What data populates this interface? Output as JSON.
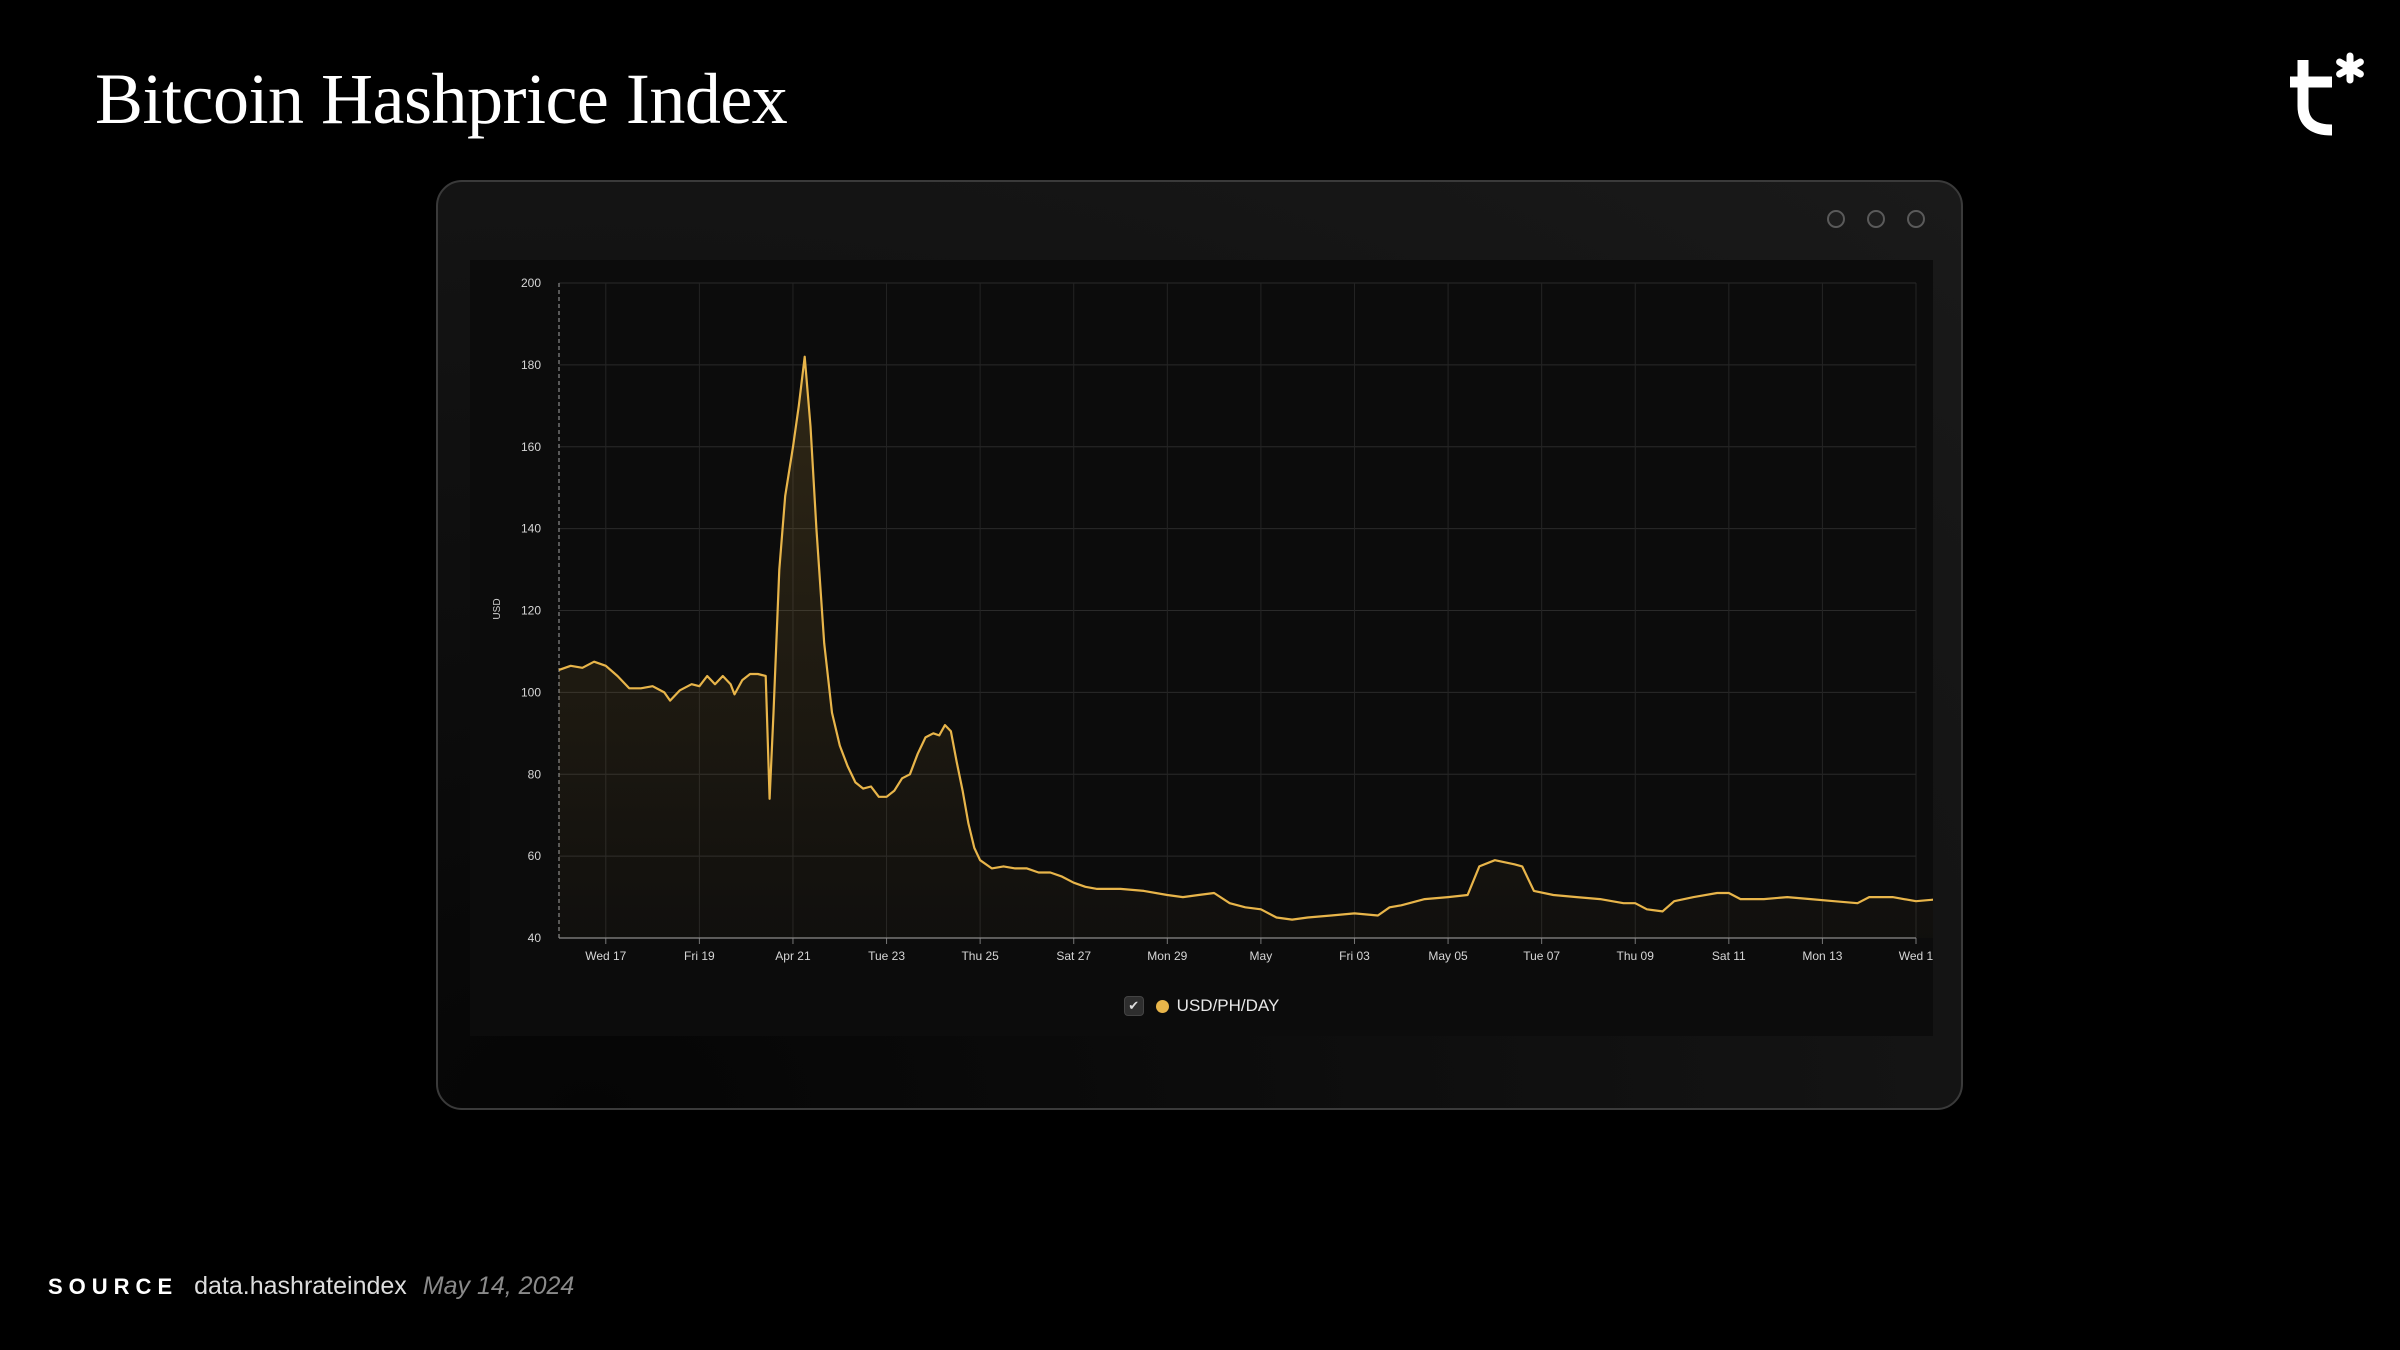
{
  "page": {
    "title": "Bitcoin Hashprice Index",
    "logo_icon": "tether-asterisk-logo-icon"
  },
  "window": {
    "controls": [
      "circle",
      "circle",
      "circle"
    ]
  },
  "legend": {
    "check": "✔",
    "label": "USD/PH/DAY",
    "color": "#e8b54a"
  },
  "source": {
    "key": "SOURCE",
    "site": "data.hashrateindex",
    "date": "May 14, 2024"
  },
  "colors": {
    "accent": "#e8b54a",
    "background": "#000000",
    "panel": "#0c0c0c"
  },
  "chart_data": {
    "type": "area",
    "ylabel": "USD",
    "ylim": [
      40,
      200
    ],
    "yticks": [
      40,
      60,
      80,
      100,
      120,
      140,
      160,
      180,
      200
    ],
    "xlim": [
      "2024-04-16",
      "2024-05-15"
    ],
    "xticks": [
      {
        "date": "2024-04-17",
        "label": "Wed 17"
      },
      {
        "date": "2024-04-19",
        "label": "Fri 19"
      },
      {
        "date": "2024-04-21",
        "label": "Apr 21"
      },
      {
        "date": "2024-04-23",
        "label": "Tue 23"
      },
      {
        "date": "2024-04-25",
        "label": "Thu 25"
      },
      {
        "date": "2024-04-27",
        "label": "Sat 27"
      },
      {
        "date": "2024-04-29",
        "label": "Mon 29"
      },
      {
        "date": "2024-05-01",
        "label": "May"
      },
      {
        "date": "2024-05-03",
        "label": "Fri 03"
      },
      {
        "date": "2024-05-05",
        "label": "May 05"
      },
      {
        "date": "2024-05-07",
        "label": "Tue 07"
      },
      {
        "date": "2024-05-09",
        "label": "Thu 09"
      },
      {
        "date": "2024-05-11",
        "label": "Sat 11"
      },
      {
        "date": "2024-05-13",
        "label": "Mon 13"
      },
      {
        "date": "2024-05-15",
        "label": "Wed 1"
      }
    ],
    "grid": true,
    "legend_position": "bottom-center",
    "series": [
      {
        "name": "USD/PH/DAY",
        "color": "#e8b54a",
        "points": [
          [
            "2024-04-16 00:00",
            105.5
          ],
          [
            "2024-04-16 06:00",
            106.5
          ],
          [
            "2024-04-16 12:00",
            106
          ],
          [
            "2024-04-16 18:00",
            107.5
          ],
          [
            "2024-04-17 00:00",
            106.5
          ],
          [
            "2024-04-17 06:00",
            104
          ],
          [
            "2024-04-17 12:00",
            101
          ],
          [
            "2024-04-17 18:00",
            101
          ],
          [
            "2024-04-18 00:00",
            101.5
          ],
          [
            "2024-04-18 06:00",
            100
          ],
          [
            "2024-04-18 09:00",
            98
          ],
          [
            "2024-04-18 14:00",
            100.5
          ],
          [
            "2024-04-18 20:00",
            102
          ],
          [
            "2024-04-19 00:00",
            101.5
          ],
          [
            "2024-04-19 04:00",
            104
          ],
          [
            "2024-04-19 08:00",
            102
          ],
          [
            "2024-04-19 12:00",
            104
          ],
          [
            "2024-04-19 16:00",
            102
          ],
          [
            "2024-04-19 18:00",
            99.5
          ],
          [
            "2024-04-19 22:00",
            103
          ],
          [
            "2024-04-20 02:00",
            104.5
          ],
          [
            "2024-04-20 06:00",
            104.5
          ],
          [
            "2024-04-20 10:00",
            104
          ],
          [
            "2024-04-20 12:00",
            74
          ],
          [
            "2024-04-20 14:00",
            95
          ],
          [
            "2024-04-20 17:00",
            130
          ],
          [
            "2024-04-20 20:00",
            148
          ],
          [
            "2024-04-21 00:00",
            160
          ],
          [
            "2024-04-21 03:00",
            170
          ],
          [
            "2024-04-21 06:00",
            182
          ],
          [
            "2024-04-21 09:00",
            165
          ],
          [
            "2024-04-21 12:00",
            140
          ],
          [
            "2024-04-21 16:00",
            112
          ],
          [
            "2024-04-21 20:00",
            95
          ],
          [
            "2024-04-22 00:00",
            87
          ],
          [
            "2024-04-22 04:00",
            82
          ],
          [
            "2024-04-22 08:00",
            78
          ],
          [
            "2024-04-22 12:00",
            76.5
          ],
          [
            "2024-04-22 16:00",
            77
          ],
          [
            "2024-04-22 20:00",
            74.5
          ],
          [
            "2024-04-23 00:00",
            74.5
          ],
          [
            "2024-04-23 04:00",
            76
          ],
          [
            "2024-04-23 08:00",
            79
          ],
          [
            "2024-04-23 12:00",
            80
          ],
          [
            "2024-04-23 16:00",
            85
          ],
          [
            "2024-04-23 20:00",
            89
          ],
          [
            "2024-04-24 00:00",
            90
          ],
          [
            "2024-04-24 03:00",
            89.5
          ],
          [
            "2024-04-24 06:00",
            92
          ],
          [
            "2024-04-24 09:00",
            90.5
          ],
          [
            "2024-04-24 12:00",
            83
          ],
          [
            "2024-04-24 15:00",
            76
          ],
          [
            "2024-04-24 18:00",
            68
          ],
          [
            "2024-04-24 21:00",
            62
          ],
          [
            "2024-04-25 00:00",
            59
          ],
          [
            "2024-04-25 06:00",
            57
          ],
          [
            "2024-04-25 12:00",
            57.5
          ],
          [
            "2024-04-25 18:00",
            57
          ],
          [
            "2024-04-26 00:00",
            57
          ],
          [
            "2024-04-26 06:00",
            56
          ],
          [
            "2024-04-26 12:00",
            56
          ],
          [
            "2024-04-26 18:00",
            55
          ],
          [
            "2024-04-27 00:00",
            53.5
          ],
          [
            "2024-04-27 06:00",
            52.5
          ],
          [
            "2024-04-27 12:00",
            52
          ],
          [
            "2024-04-28 00:00",
            52
          ],
          [
            "2024-04-28 12:00",
            51.5
          ],
          [
            "2024-04-29 00:00",
            50.5
          ],
          [
            "2024-04-29 08:00",
            50
          ],
          [
            "2024-04-29 16:00",
            50.5
          ],
          [
            "2024-04-30 00:00",
            51
          ],
          [
            "2024-04-30 08:00",
            48.5
          ],
          [
            "2024-04-30 16:00",
            47.5
          ],
          [
            "2024-05-01 00:00",
            47
          ],
          [
            "2024-05-01 08:00",
            45
          ],
          [
            "2024-05-01 16:00",
            44.5
          ],
          [
            "2024-05-02 00:00",
            45
          ],
          [
            "2024-05-02 12:00",
            45.5
          ],
          [
            "2024-05-03 00:00",
            46
          ],
          [
            "2024-05-03 12:00",
            45.5
          ],
          [
            "2024-05-03 18:00",
            47.5
          ],
          [
            "2024-05-04 00:00",
            48
          ],
          [
            "2024-05-04 12:00",
            49.5
          ],
          [
            "2024-05-05 00:00",
            50
          ],
          [
            "2024-05-05 10:00",
            50.5
          ],
          [
            "2024-05-05 16:00",
            57.5
          ],
          [
            "2024-05-06 00:00",
            59
          ],
          [
            "2024-05-06 10:00",
            58
          ],
          [
            "2024-05-06 14:00",
            57.5
          ],
          [
            "2024-05-06 20:00",
            51.5
          ],
          [
            "2024-05-07 06:00",
            50.5
          ],
          [
            "2024-05-07 18:00",
            50
          ],
          [
            "2024-05-08 06:00",
            49.5
          ],
          [
            "2024-05-08 18:00",
            48.5
          ],
          [
            "2024-05-09 00:00",
            48.5
          ],
          [
            "2024-05-09 06:00",
            47
          ],
          [
            "2024-05-09 14:00",
            46.5
          ],
          [
            "2024-05-09 20:00",
            49
          ],
          [
            "2024-05-10 06:00",
            50
          ],
          [
            "2024-05-10 18:00",
            51
          ],
          [
            "2024-05-11 00:00",
            51
          ],
          [
            "2024-05-11 06:00",
            49.5
          ],
          [
            "2024-05-11 18:00",
            49.5
          ],
          [
            "2024-05-12 06:00",
            50
          ],
          [
            "2024-05-12 18:00",
            49.5
          ],
          [
            "2024-05-13 06:00",
            49
          ],
          [
            "2024-05-13 18:00",
            48.5
          ],
          [
            "2024-05-14 00:00",
            50
          ],
          [
            "2024-05-14 12:00",
            50
          ],
          [
            "2024-05-15 00:00",
            49
          ],
          [
            "2024-05-15 12:00",
            49.5
          ]
        ]
      }
    ]
  }
}
